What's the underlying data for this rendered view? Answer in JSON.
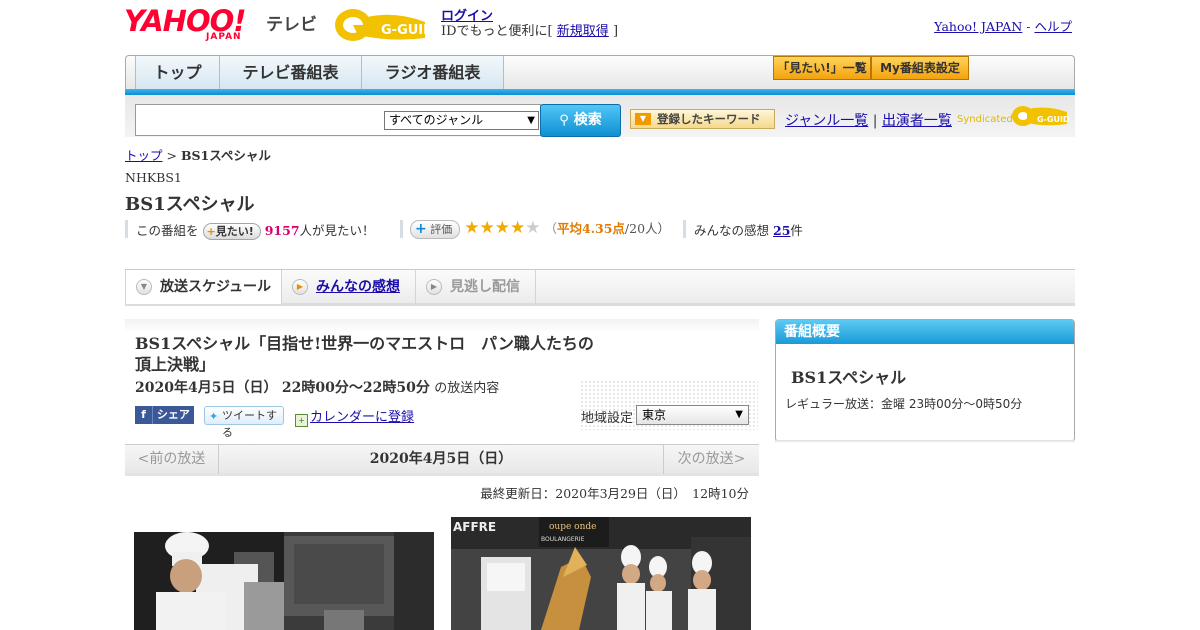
{
  "header": {
    "yahoo_logo_main": "YAHOO!",
    "yahoo_logo_sub": "JAPAN",
    "tv_label": "テレビ",
    "gguide_logo": "G-GUIDE",
    "login_label": "ログイン",
    "login_note_prefix": "IDでもっと便利に[",
    "signup_label": "新規取得",
    "login_note_suffix": "]",
    "yahoo_japan_link": "Yahoo! JAPAN",
    "separator": "-",
    "help_link": "ヘルプ"
  },
  "nav": {
    "tabs": [
      {
        "label": "トップ"
      },
      {
        "label": "テレビ番組表"
      },
      {
        "label": "ラジオ番組表"
      }
    ],
    "mitai_list": "「見たい!」一覧",
    "my_program": "My番組表設定"
  },
  "search": {
    "placeholder": "",
    "genre_selected": "すべてのジャンル",
    "button_label": "検索",
    "keyword_button": "登録したキーワード",
    "genre_list_link": "ジャンル一覧",
    "link_separator": "|",
    "performer_list_link": "出演者一覧",
    "syndicated_label": "Syndicated",
    "syndicated_logo": "G-GUIDE"
  },
  "breadcrumb": {
    "top": "トップ",
    "sep": ">",
    "current": "BS1スペシャル"
  },
  "program": {
    "channel": "NHKBS1",
    "title": "BS1スペシャル",
    "mitai_prefix": "この番組を",
    "mitai_button": "見たい!",
    "mitai_count": "9157",
    "mitai_suffix": "人が見たい！",
    "hyoka_button": "評価",
    "rating_value": 4.35,
    "rating_text_open": "（",
    "rating_avg": "平均4.35点",
    "rating_count": "/20人）",
    "kansou_label": "みんなの感想",
    "kansou_count": "25",
    "kansou_suffix": "件"
  },
  "tabs": [
    {
      "label": "放送スケジュール",
      "state": "active"
    },
    {
      "label": "みんなの感想",
      "state": "link"
    },
    {
      "label": "見逃し配信",
      "state": "disabled"
    }
  ],
  "episode": {
    "title": "BS1スペシャル「目指せ!世界一のマエストロ　パン職人たちの頂上決戦」",
    "date": "2020年4月5日（日）",
    "time": "22時00分～22時50分",
    "suffix": "の放送内容",
    "fb_share": "シェア",
    "tweet": "ツイートする",
    "calendar": "カレンダーに登録",
    "region_label": "地域設定",
    "region_selected": "東京"
  },
  "pager": {
    "prev": "<前の放送",
    "current": "2020年4月5日（日）",
    "next": "次の放送>"
  },
  "updated": "最終更新日：2020年3月29日（日）　12時10分",
  "photo2_sign": {
    "left": "AFFRE",
    "right": "oupe onde",
    "small": "BOULANGERIE"
  },
  "sidebar": {
    "heading": "番組概要",
    "title": "BS1スペシャル",
    "regular": "レギュラー放送：金曜 23時00分～0時50分"
  },
  "colors": {
    "accent_blue": "#0b8bd2",
    "orange": "#f4a20d",
    "count_pink": "#d6006d",
    "rating_orange": "#e07b00"
  }
}
